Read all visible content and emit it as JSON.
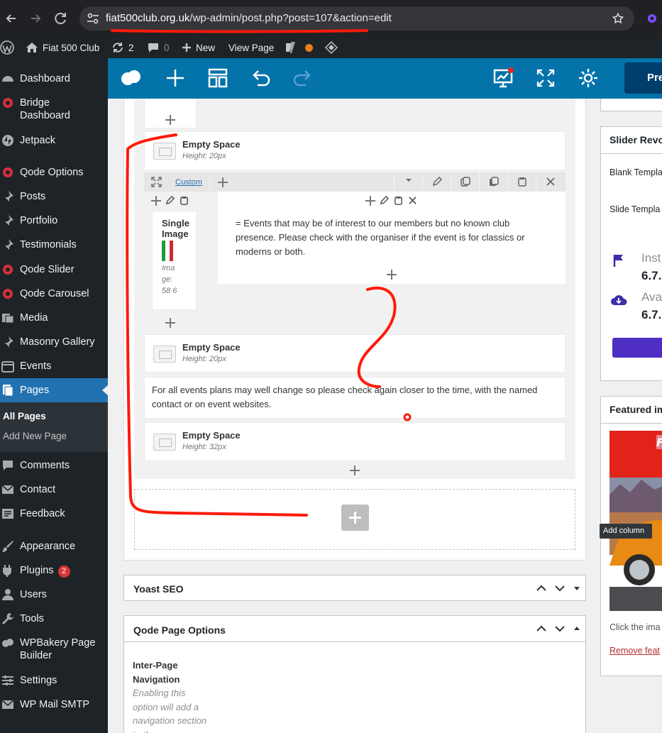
{
  "browser": {
    "url_domain": "fiat500club.org.uk",
    "url_path": "/wp-admin/post.php?post=107&action=edit"
  },
  "admin_bar": {
    "site_name": "Fiat 500 Club",
    "updates_count": "2",
    "comments_count": "0",
    "new_label": "New",
    "view_page_label": "View Page"
  },
  "sidebar": {
    "items": [
      {
        "label": "Dashboard"
      },
      {
        "label": "Bridge Dashboard"
      },
      {
        "label": "Jetpack"
      },
      {
        "label": "Qode Options"
      },
      {
        "label": "Posts"
      },
      {
        "label": "Portfolio"
      },
      {
        "label": "Testimonials"
      },
      {
        "label": "Qode Slider"
      },
      {
        "label": "Qode Carousel"
      },
      {
        "label": "Media"
      },
      {
        "label": "Masonry Gallery"
      },
      {
        "label": "Events"
      },
      {
        "label": "Pages"
      },
      {
        "label": "Comments"
      },
      {
        "label": "Contact"
      },
      {
        "label": "Feedback"
      },
      {
        "label": "Appearance"
      },
      {
        "label": "Plugins"
      },
      {
        "label": "Users"
      },
      {
        "label": "Tools"
      },
      {
        "label": "WPBakery Page Builder"
      },
      {
        "label": "Settings"
      },
      {
        "label": "WP Mail SMTP"
      }
    ],
    "plugins_badge": "2",
    "submenu": {
      "all_pages": "All Pages",
      "add_new_page": "Add New Page"
    }
  },
  "toolbar": {
    "preview_label": "Pre"
  },
  "editor": {
    "empty_space_1": {
      "title": "Empty Space",
      "height": "Height: 20px"
    },
    "row_custom_label": "Custom",
    "single_image": {
      "title": "Single Image",
      "meta": "Ima ge: 58 6"
    },
    "events_text": "= Events that may be of interest to our members but no known club presence. Please check with the organiser if the event is for classics or moderns or both.",
    "empty_space_2": {
      "title": "Empty Space",
      "height": "Height: 20px"
    },
    "plans_text": "For all events plans may well change so please check again closer to the time, with the named contact or on event websites.",
    "empty_space_3": {
      "title": "Empty Space",
      "height": "Height: 32px"
    }
  },
  "yoast": {
    "title": "Yoast SEO"
  },
  "qode_page_options": {
    "title": "Qode Page Options",
    "inter_page_nav_label": "Inter-Page Navigation",
    "inter_page_nav_desc": "Enabling this option will add a navigation section to the"
  },
  "right_column": {
    "slider_revolution_title": "Slider Revo",
    "blank_template": "Blank Templa",
    "slide_template": "Slide Templa",
    "installed_label": "Inst",
    "installed_version": "6.7.",
    "available_label": "Ava",
    "available_version": "6.7.",
    "featured_title": "Featured im",
    "click_image_text": "Click the ima",
    "remove_featured": "Remove feat",
    "tooltip_add_column": "Add column"
  },
  "colors": {
    "wp_admin_dark": "#1d2327",
    "active_blue": "#2271b1",
    "wpbakery_blue": "#0473aa",
    "annotation_red": "#ff1a0a"
  }
}
